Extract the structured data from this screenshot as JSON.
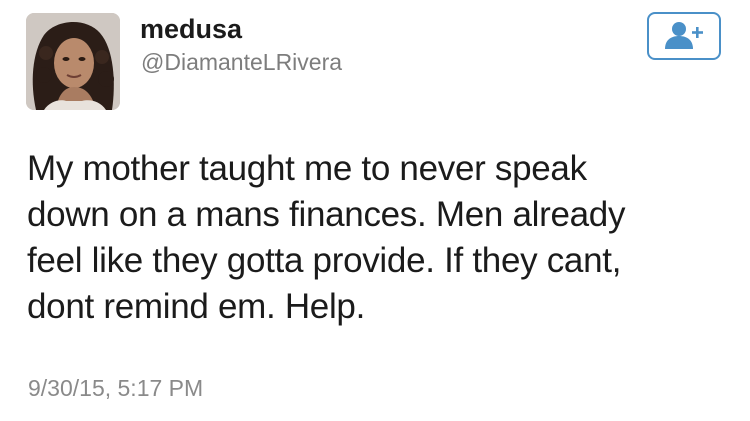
{
  "user": {
    "display_name": "medusa",
    "handle": "@DiamanteLRivera",
    "avatar_icon": "profile-photo"
  },
  "follow_button": {
    "icon": "add-user-icon",
    "color": "#4a90c8"
  },
  "tweet": {
    "lines": [
      "My mother taught me to never speak",
      "down on a mans finances. Men already",
      "feel like they gotta provide. If they cant,",
      "dont remind em. Help."
    ],
    "timestamp": "9/30/15, 5:17 PM"
  }
}
